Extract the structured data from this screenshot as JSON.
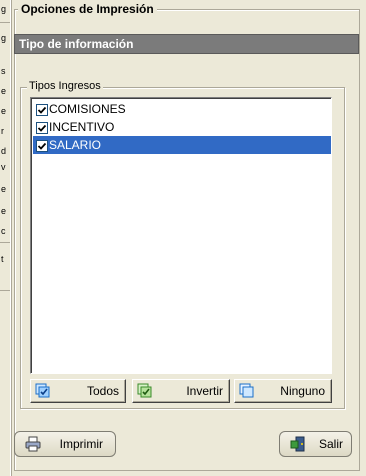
{
  "left_strip": {
    "chars": [
      "g",
      "g",
      "s",
      "e",
      "e",
      "r",
      "d",
      "v",
      "e",
      "e",
      "c",
      "t"
    ]
  },
  "main": {
    "title": "Opciones de Impresión",
    "info_bar": "Tipo de información",
    "group_title": "Tipos Ingresos",
    "items": [
      {
        "label": "COMISIONES",
        "checked": true,
        "selected": false
      },
      {
        "label": "INCENTIVO",
        "checked": true,
        "selected": false
      },
      {
        "label": "SALARIO",
        "checked": true,
        "selected": true
      }
    ],
    "buttons": {
      "todos": "Todos",
      "invertir": "Invertir",
      "ninguno": "Ninguno",
      "imprimir": "Imprimir",
      "salir": "Salir"
    }
  },
  "colors": {
    "background": "#ece9d8",
    "info_bar": "#7b7b7b",
    "selection": "#316ac5"
  },
  "icons": [
    "check-all-icon",
    "invert-icon",
    "uncheck-all-icon",
    "printer-icon",
    "exit-icon"
  ]
}
